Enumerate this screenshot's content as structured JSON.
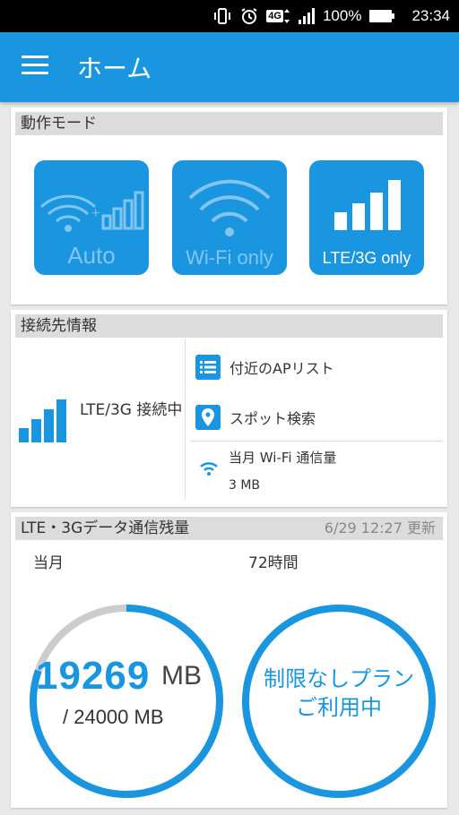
{
  "status_bar": {
    "battery": "100%",
    "time": "23:34",
    "network": "4G",
    "icons": [
      "vibrate-icon",
      "alarm-icon",
      "4g-icon",
      "signal-icon",
      "battery-icon"
    ]
  },
  "app_bar": {
    "title": "ホーム",
    "menu_icon": "hamburger-menu-icon"
  },
  "operation_mode": {
    "header": "動作モード",
    "modes": [
      {
        "id": "auto",
        "label": "Auto",
        "selected": false
      },
      {
        "id": "wifi",
        "label": "Wi-Fi only",
        "selected": false
      },
      {
        "id": "lte",
        "label": "LTE/3G only",
        "selected": true
      }
    ]
  },
  "connection": {
    "header": "接続先情報",
    "status": "LTE/3G 接続中",
    "nearby_ap_list": "付近のAPリスト",
    "spot_search": "スポット検索",
    "wifi_usage_label": "当月 Wi-Fi 通信量",
    "wifi_usage_value": "3 MB"
  },
  "remaining_data": {
    "header": "LTE・3Gデータ通信残量",
    "updated": "6/29 12:27 更新",
    "month_label": "当月",
    "hours_label": "72時間",
    "remaining": "19269",
    "remaining_unit": "MB",
    "total": "/ 24000 MB",
    "remaining_fraction": 0.803,
    "plan_line1": "制限なしプラン",
    "plan_line2": "ご利用中"
  },
  "colors": {
    "accent": "#1a96e0",
    "header_bg": "#dcdcdc",
    "gauge_track": "#cccccc"
  }
}
